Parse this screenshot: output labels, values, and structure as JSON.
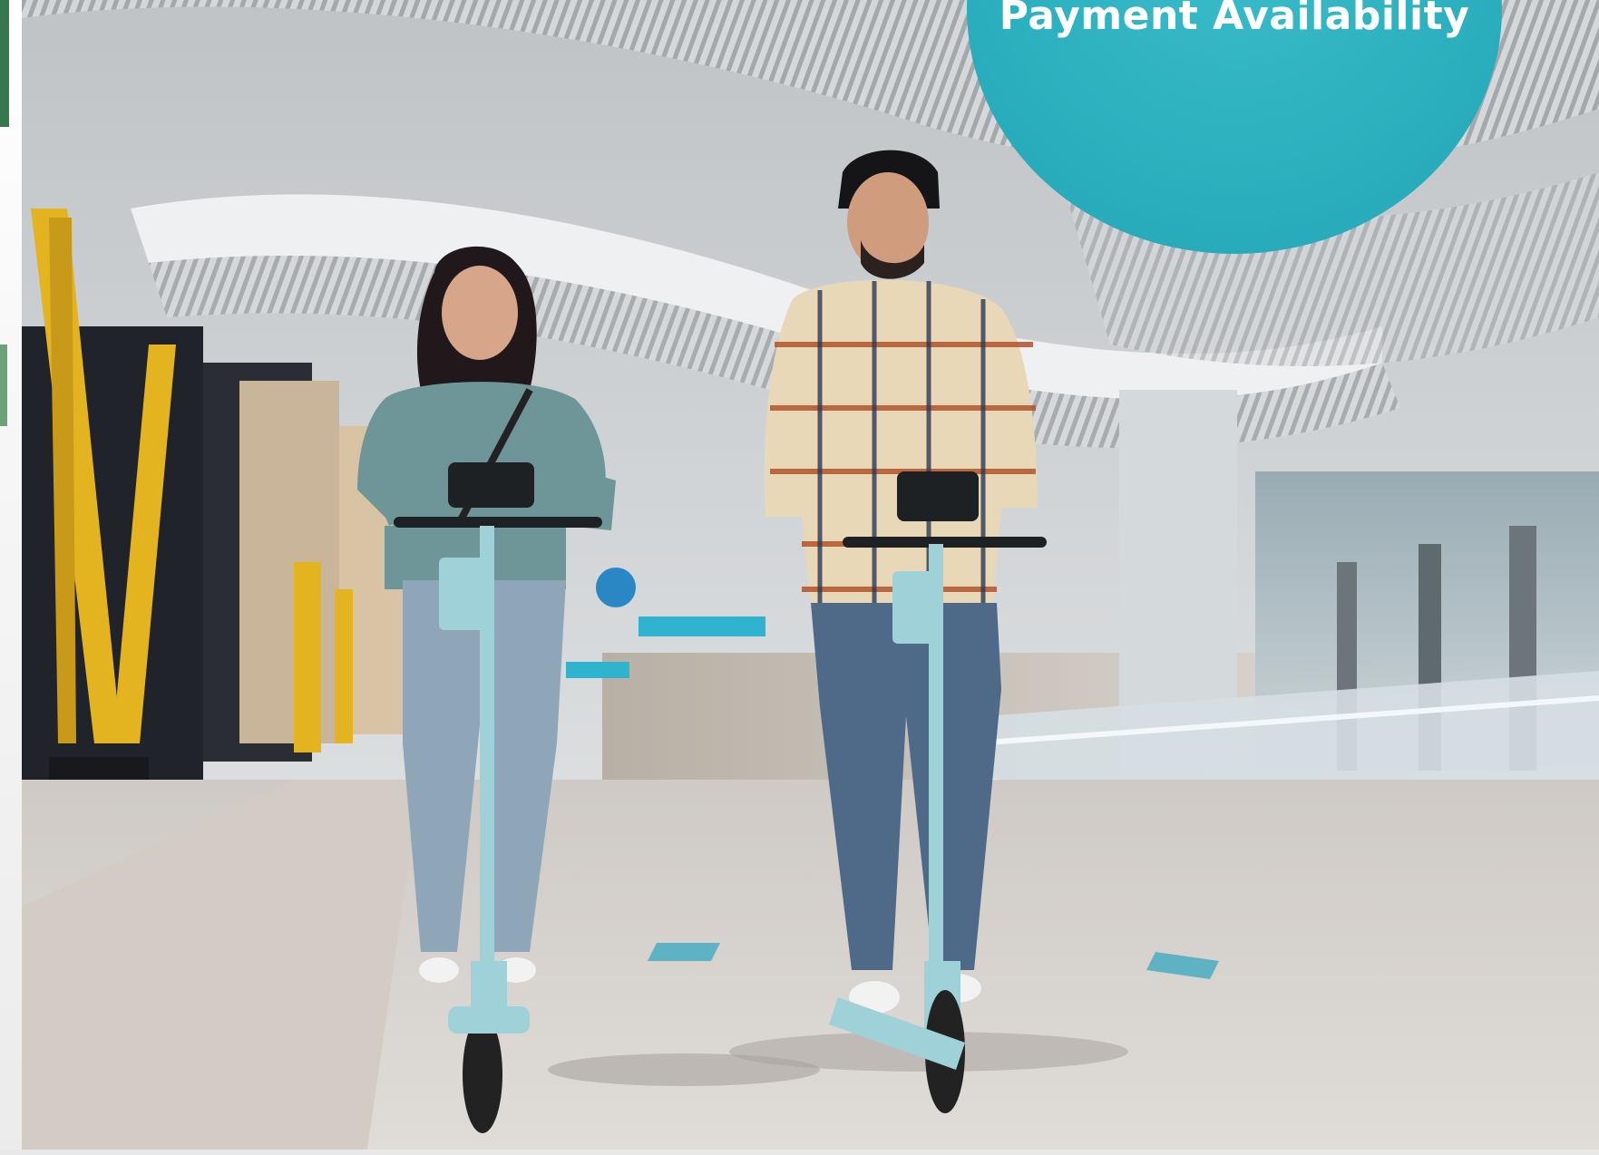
{
  "badge": {
    "title": "Payment Availability",
    "color": "#2aaebd"
  },
  "colors": {
    "scooter": "#9fd1d9",
    "column": "#e3b320",
    "floor": "#d7d3cf"
  }
}
